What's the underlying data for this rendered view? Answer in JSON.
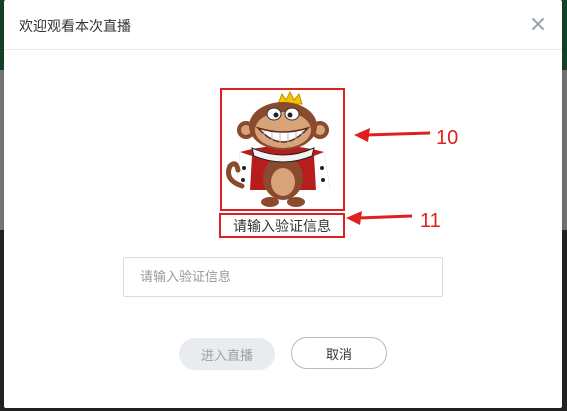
{
  "dialog": {
    "title": "欢迎观看本次直播",
    "close_icon": "close-icon"
  },
  "verification": {
    "image_alt_icon": "monkey-king-image",
    "hint_text": "请输入验证信息",
    "input_placeholder": "请输入验证信息",
    "input_value": ""
  },
  "buttons": {
    "enter_label": "进入直播",
    "cancel_label": "取消"
  },
  "annotations": {
    "image_number": "10",
    "hint_number": "11"
  },
  "colors": {
    "annotation_red": "#e02020",
    "button_disabled_bg": "#e9ecef"
  }
}
